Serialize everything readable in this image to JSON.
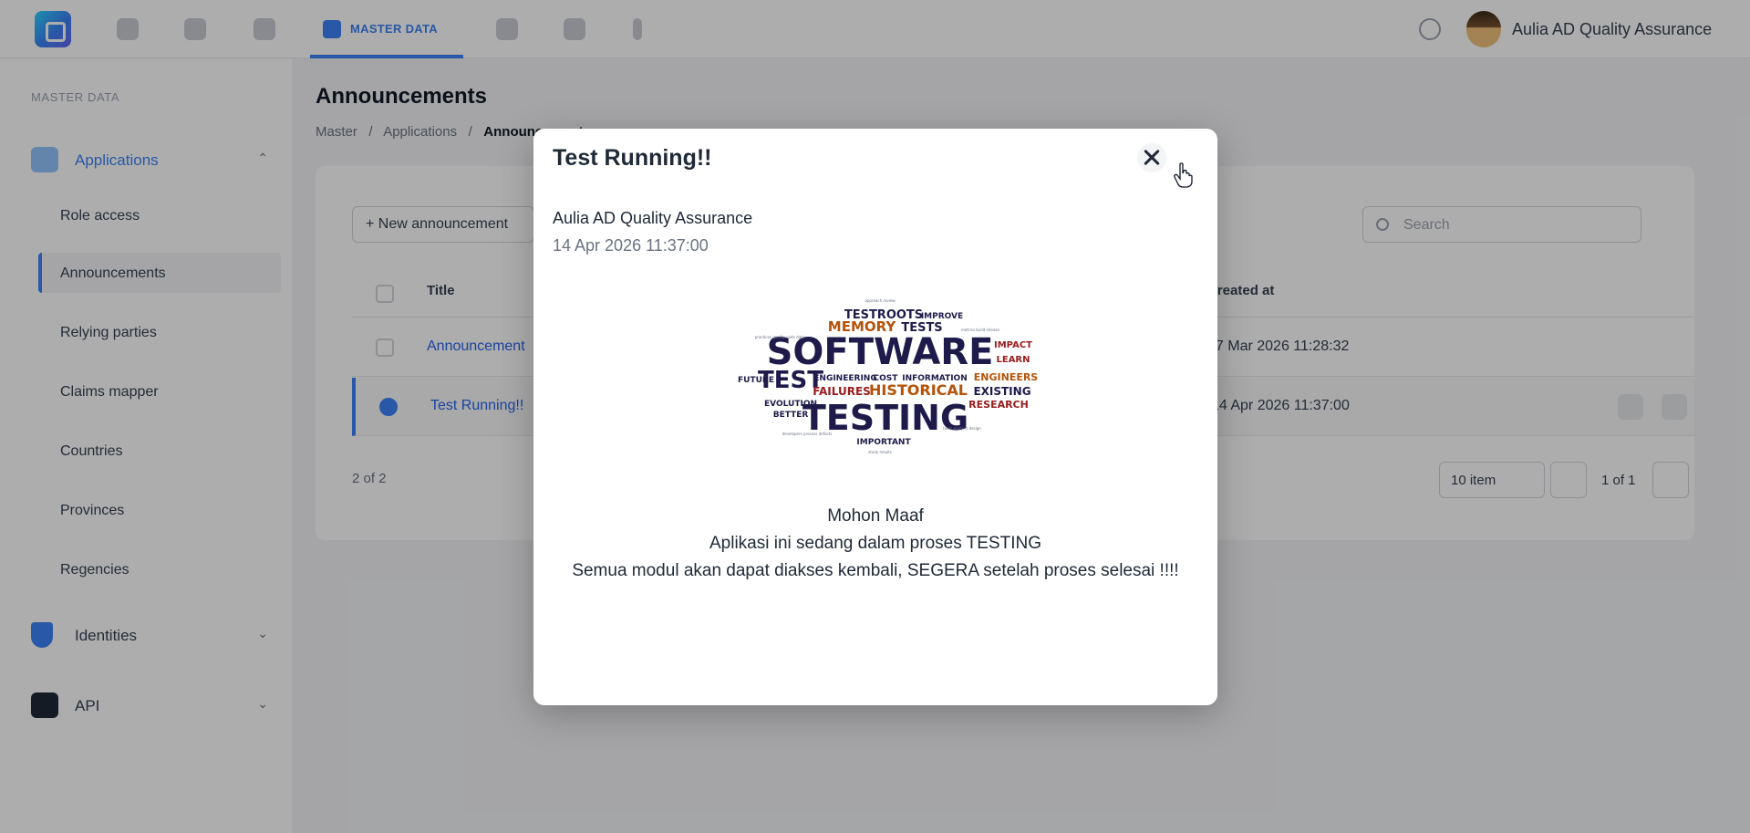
{
  "topbar": {
    "active_tab": "MASTER DATA",
    "user_name": "Aulia AD Quality Assurance",
    "icons": [
      "app-logo",
      "dashboard-icon",
      "home-icon",
      "settings-icon",
      "master-data-icon",
      "globe-icon",
      "shield-icon",
      "more-icon",
      "bell-icon"
    ]
  },
  "sidebar": {
    "section": "MASTER DATA",
    "groups": [
      {
        "label": "Applications",
        "items": [
          "Role access",
          "Announcements",
          "Relying parties",
          "Claims mapper",
          "Countries",
          "Provinces",
          "Regencies"
        ]
      },
      {
        "label": "Identities"
      },
      {
        "label": "API"
      }
    ]
  },
  "main": {
    "title": "Announcements",
    "breadcrumb": [
      "Master",
      "Applications",
      "Announcements"
    ],
    "new_button": "+ New announcement",
    "search_placeholder": "Search",
    "columns": [
      "Title",
      "Created at"
    ],
    "rows": [
      {
        "title": "Announcement",
        "created": "17 Mar 2026 11:28:32"
      },
      {
        "title": "Test Running!!",
        "created": "14 Apr 2026 11:37:00"
      }
    ],
    "count": "2 of 2",
    "per_page": "10 item",
    "page_info": "1 of 1"
  },
  "modal": {
    "title": "Test Running!!",
    "author": "Aulia AD Quality Assurance",
    "date": "14 Apr 2026 11:37:00",
    "image_words": [
      "SOFTWARE",
      "TESTING",
      "TEST",
      "HISTORICAL",
      "FAILURES",
      "MEMORY",
      "TESTS",
      "TESTROOTS",
      "IMPROVE",
      "ENGINEERING",
      "COST",
      "INFORMATION",
      "ENGINEERS",
      "EXISTING",
      "RESEARCH",
      "EVOLUTION",
      "BETTER",
      "FUTURE",
      "IMPORTANT",
      "LEARN",
      "IMPACT"
    ],
    "body": [
      "Mohon Maaf",
      "Aplikasi ini sedang dalam proses TESTING",
      "Semua modul akan dapat diakses kembali, SEGERA setelah proses selesai !!!!"
    ]
  },
  "colors": {
    "accent": "#3b82f6",
    "overlay": "rgba(0,0,0,0.32)",
    "cloud_navy": "#1e1b4b",
    "cloud_orange": "#b45309",
    "cloud_red": "#991b1b"
  }
}
